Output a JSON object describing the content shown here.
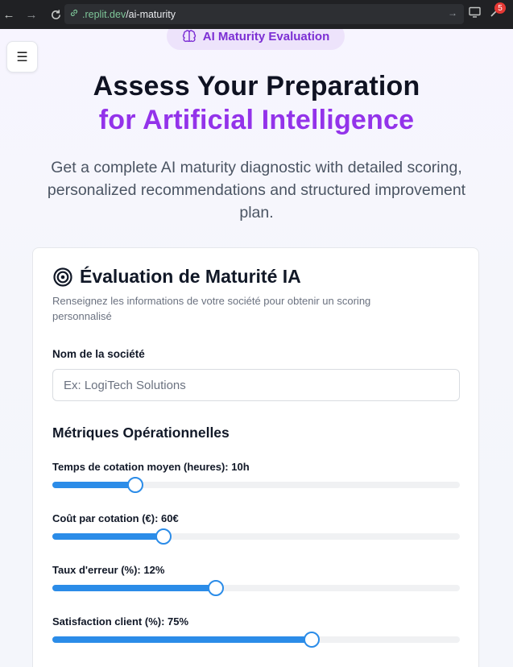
{
  "browser": {
    "url_host": ".replit.dev",
    "url_path": "/ai-maturity",
    "notification_count": "5"
  },
  "hero": {
    "badge": "AI Maturity Evaluation",
    "title_line1": "Assess Your Preparation",
    "title_line2": "for Artificial Intelligence",
    "subtitle": "Get a complete AI maturity diagnostic with detailed scoring, personalized recommendations and structured improvement plan."
  },
  "card": {
    "title": "Évaluation de Maturité IA",
    "description": "Renseignez les informations de votre société pour obtenir un scoring personnalisé",
    "company_label": "Nom de la société",
    "company_value": "",
    "company_placeholder": "Ex: LogiTech Solutions",
    "section_title": "Métriques Opérationnelles",
    "sliders": [
      {
        "label": "Temps de cotation moyen (heures): 10h",
        "fraction": 0.203
      },
      {
        "label": "Coût par cotation (€): 60€",
        "fraction": 0.273
      },
      {
        "label": "Taux d'erreur (%): 12%",
        "fraction": 0.402
      },
      {
        "label": "Satisfaction client (%): 75%",
        "fraction": 0.636
      }
    ]
  },
  "colors": {
    "accent": "#9333ea",
    "slider": "#2b8ce8",
    "badge_bg": "#ede3fb"
  },
  "icons": {
    "badge_icon": "brain-icon",
    "card_icon": "target-icon",
    "menu_icon": "hamburger-menu-icon"
  }
}
